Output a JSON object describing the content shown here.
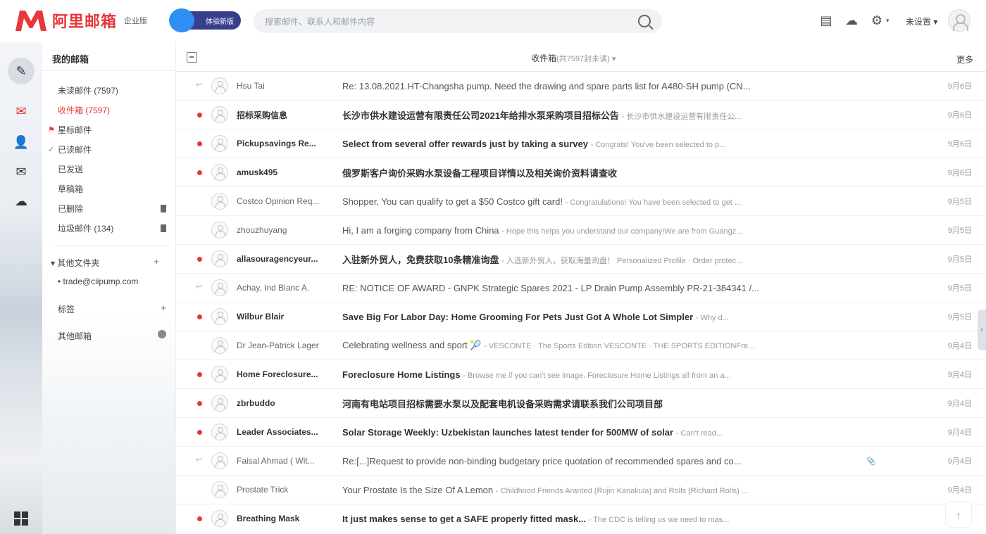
{
  "app": {
    "logo_text": "阿里邮箱",
    "logo_sub": "企业版",
    "badge_label": "体验新版",
    "brand_color": "#e8363a"
  },
  "search": {
    "placeholder": "搜索邮件、联系人和邮件内容"
  },
  "topbar": {
    "user_name": "未设置 ▾",
    "settings_label": "▾"
  },
  "folders": {
    "title": "我的邮箱",
    "items": [
      {
        "label": "未读邮件 (7597)",
        "mark": "",
        "active": false
      },
      {
        "label": "收件箱 (7597)",
        "mark": "",
        "active": true
      },
      {
        "label": "星标邮件",
        "mark": "red-flag",
        "active": false
      },
      {
        "label": "已读邮件",
        "mark": "green-check",
        "active": false
      },
      {
        "label": "已发送",
        "mark": "",
        "active": false
      },
      {
        "label": "草稿箱",
        "mark": "",
        "active": false
      },
      {
        "label": "已删除",
        "mark": "",
        "active": false,
        "trash": true
      },
      {
        "label": "垃圾邮件 (134)",
        "mark": "",
        "active": false,
        "trash": true
      }
    ],
    "groups": [
      {
        "label": "▾  其他文件夹",
        "action": "+"
      },
      {
        "label": "• trade@ciipump.com",
        "action": ""
      },
      {
        "label": "标签",
        "action": "+"
      },
      {
        "label": "其他邮箱",
        "action": "dot"
      }
    ]
  },
  "list": {
    "title": "收件箱",
    "title_sub": "(共7597封未读) ▾",
    "right_label": "更多",
    "rows": [
      {
        "indicator": "reply",
        "sender": "Hsu Tai",
        "subject": "Re: 13.08.2021.HT-Changsha pump. Need the drawing and spare parts list for A480-SH pump (CN...",
        "snippet": "",
        "date": "9月6日",
        "unread": false
      },
      {
        "indicator": "dot",
        "sender": "招标采购信息",
        "subject": "长沙市供水建设运营有限责任公司2021年给排水泵采购项目招标公告",
        "snippet": "- 长沙市供水建设运营有限责任公...",
        "date": "9月6日",
        "unread": true
      },
      {
        "indicator": "dot",
        "sender": "Pickupsavings Re...",
        "subject": "Select from several offer rewards just by taking a survey",
        "snippet": "- Congrats! You've been selected to p...",
        "date": "9月6日",
        "unread": true
      },
      {
        "indicator": "dot",
        "sender": "amusk495",
        "subject": "俄罗斯客户询价采购水泵设备工程项目详情以及相关询价资料请查收",
        "snippet": "",
        "date": "9月6日",
        "unread": true
      },
      {
        "indicator": "",
        "sender": "Costco Opinion Req...",
        "subject": "Shopper, You can qualify to get a $50 Costco gift card!",
        "snippet": "- Congratulations! You have been selected to get ...",
        "date": "9月5日",
        "unread": false
      },
      {
        "indicator": "",
        "sender": "zhouzhuyang",
        "subject": "Hi, I am a forging company from China",
        "snippet": "- Hope this helps you understand our company!We are from Guangz...",
        "date": "9月5日",
        "unread": false
      },
      {
        "indicator": "dot",
        "sender": "allasouragencyeur...",
        "subject": "入驻新外贸人，免费获取10条精准询盘",
        "snippet": "- 入选新外贸人，获取海量询盘！ Personalized Profile · Order protec...",
        "date": "9月5日",
        "unread": true
      },
      {
        "indicator": "reply",
        "sender": "Achay, Ind Blanc A.",
        "subject": "RE: NOTICE OF AWARD - GNPK Strategic Spares 2021 - LP Drain Pump Assembly PR-21-384341 /...",
        "snippet": "",
        "date": "9月5日",
        "unread": false
      },
      {
        "indicator": "dot",
        "sender": "Wilbur Blair",
        "subject": "Save Big For Labor Day: Home Grooming For Pets Just Got A Whole Lot Simpler",
        "snippet": "- Why d...",
        "date": "9月5日",
        "unread": true
      },
      {
        "indicator": "",
        "sender": "Dr Jean-Patrick Lager",
        "subject": "Celebrating wellness and sport 🎾",
        "snippet": "- VESCONTE · The Sports Edition VESCONTE · THE SPORTS EDITIONFre...",
        "date": "9月4日",
        "unread": false
      },
      {
        "indicator": "dot",
        "sender": "Home Foreclosure...",
        "subject": "Foreclosure Home Listings",
        "snippet": "- Browse me if you can't see image. Foreclosure Home Listings all from an a...",
        "date": "9月4日",
        "unread": true
      },
      {
        "indicator": "dot",
        "sender": "zbrbuddo",
        "subject": "河南有电站项目招标需要水泵以及配套电机设备采购需求请联系我们公司项目部",
        "snippet": "",
        "date": "9月4日",
        "unread": true
      },
      {
        "indicator": "dot",
        "sender": "Leader Associates...",
        "subject": "Solar Storage Weekly: Uzbekistan launches latest tender for 500MW of solar",
        "snippet": "- Can't read...",
        "date": "9月4日",
        "unread": true
      },
      {
        "indicator": "reply",
        "sender": "Faisal Ahmad ( Wit...",
        "subject": "Re:[...]Request to provide non-binding budgetary price quotation of recommended spares and co...",
        "snippet": "",
        "date": "9月4日",
        "unread": false,
        "clip": "📎"
      },
      {
        "indicator": "",
        "sender": "Prostate Trick",
        "subject": "Your Prostate Is the Size Of A Lemon",
        "snippet": "- Childhood Friends Aranted (Rujin Kanakula) and Rolls (Richard Rolls) ...",
        "date": "9月4日",
        "unread": false
      },
      {
        "indicator": "dot",
        "sender": "Breathing Mask",
        "subject": "It just makes sense to get a SAFE properly fitted mask...",
        "snippet": "- The CDC is telling us we need to mas...",
        "date": "9月3日",
        "unread": true
      }
    ]
  },
  "icons": {
    "compose": "pencil-icon",
    "mail": "mail-icon",
    "contacts": "contacts-icon",
    "messages": "envelope-icon",
    "cloud": "cloud-icon",
    "apps": "apps-grid-icon"
  }
}
